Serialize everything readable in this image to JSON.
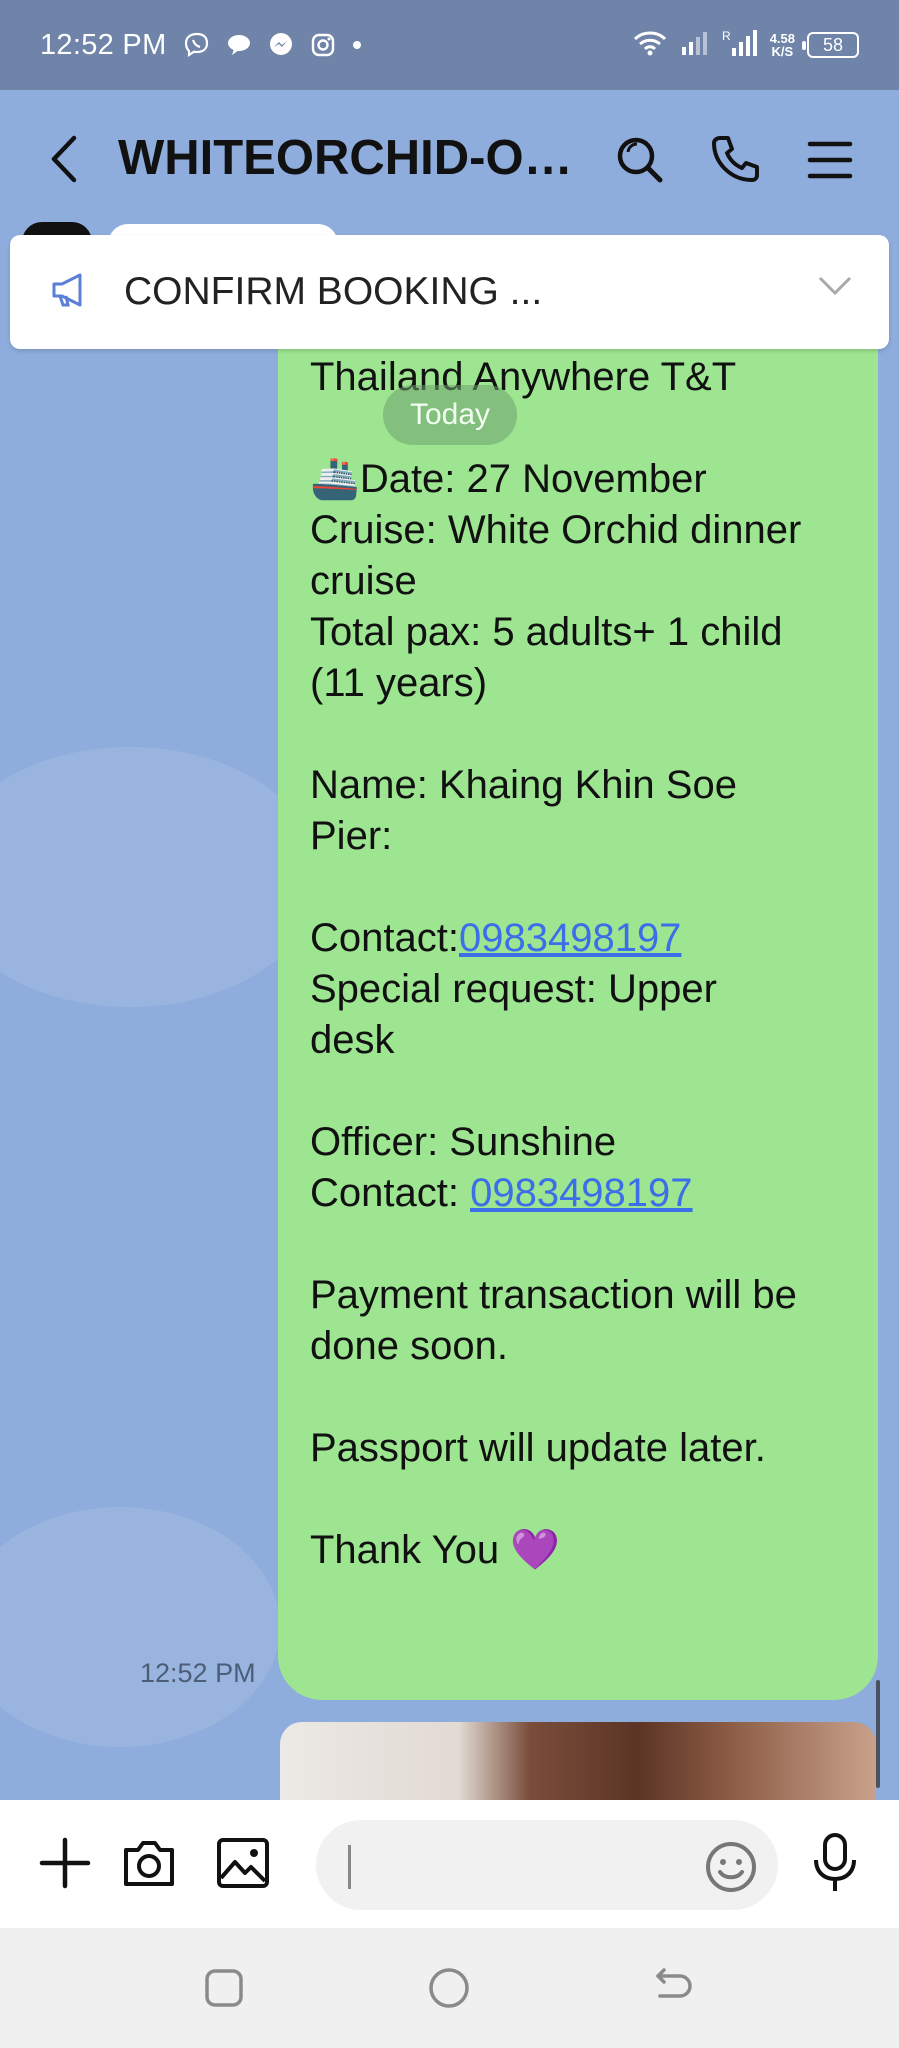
{
  "status_bar": {
    "time": "12:52 PM",
    "net_speed_value": "4.58",
    "net_speed_unit": "K/S",
    "battery": "58",
    "icons": [
      "viber-icon",
      "chat-bubble-icon",
      "messenger-icon",
      "instagram-icon",
      "dot-icon",
      "wifi-icon",
      "signal-icon",
      "signal-roaming-icon"
    ]
  },
  "header": {
    "title": "WHITEORCHID-ON...",
    "icons": [
      "back-icon",
      "search-icon",
      "phone-icon",
      "menu-icon"
    ]
  },
  "announcement": {
    "text": "CONFIRM BOOKING ...",
    "icon": "megaphone-icon"
  },
  "chat": {
    "today_label": "Today",
    "message_time": "12:52 PM",
    "message": {
      "line1": "Thailand Anywhere T&T",
      "date": "Date: 27 November",
      "cruise": "Cruise: White Orchid dinner\ncruise",
      "pax": "Total pax: 5 adults+ 1 child\n(11 years)",
      "name": "Name: Khaing Khin Soe",
      "pier": "Pier:",
      "contact_label": "Contact:",
      "contact_number": "0983498197",
      "special_request": "Special request: Upper\ndesk",
      "officer": "Officer: Sunshine",
      "officer_contact_label": "Contact: ",
      "officer_contact_number": "0983498197",
      "payment": "Payment transaction will be\ndone soon.",
      "passport": "Passport will update later.",
      "thanks": "Thank You",
      "ship_emoji": "🚢",
      "heart_emoji": "💜"
    }
  },
  "input_bar": {
    "placeholder": "",
    "icons": [
      "plus-icon",
      "camera-icon",
      "image-icon",
      "emoji-icon",
      "microphone-icon"
    ]
  },
  "nav_bar": {
    "icons": [
      "recent-apps-icon",
      "home-icon",
      "back-nav-icon"
    ]
  },
  "colors": {
    "status_bar_bg": "#6f84a8",
    "chat_bg": "#8eaddc",
    "bubble_green": "#9de590",
    "link_blue": "#3b6ee8"
  }
}
